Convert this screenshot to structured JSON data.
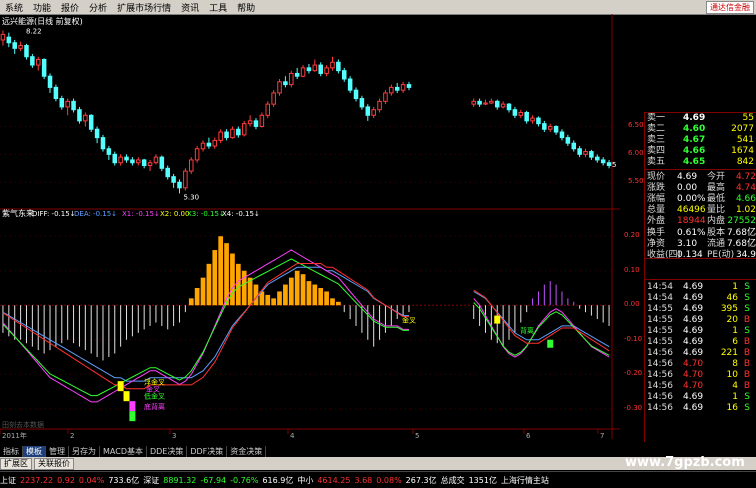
{
  "menu": [
    "系统",
    "功能",
    "报价",
    "分析",
    "扩展市场行情",
    "资讯",
    "工具",
    "帮助"
  ],
  "menu_right": "通达信金融",
  "chart_title": "远兴能源(日线 前复权)",
  "price_high_label": "8.22",
  "price_low_label": "5.30",
  "right_axis_labels": [
    "6.50",
    "6.00",
    "5.50",
    "5"
  ],
  "indicator_header": {
    "name": "紫气东来",
    "diff": "DIFF: -0.15↓",
    "dea": "DEA: -0.15↓",
    "x1": "X1: -0.15↓",
    "x2": "X2: 0.00",
    "x3": "X3: -0.15↓",
    "x4": "X4: -0.15↓"
  },
  "indicator_axis_labels": [
    "0.20",
    "0.10",
    "0.00",
    "-0.10",
    "-0.20",
    "-0.30"
  ],
  "indicator_annotations": [
    "浮金叉",
    "金叉",
    "低金叉",
    "底背离",
    "背离",
    "金叉"
  ],
  "xaxis": [
    "2011年",
    "2",
    "3",
    "4",
    "5",
    "6",
    "7"
  ],
  "copyright": "田刻去本数据",
  "quote_board": {
    "asks": [
      {
        "label": "卖一",
        "price": "4.69",
        "vol": "55"
      },
      {
        "label": "卖二",
        "price": "4.60",
        "vol": "2077"
      },
      {
        "label": "卖三",
        "price": "4.67",
        "vol": "541"
      },
      {
        "label": "卖四",
        "price": "4.66",
        "vol": "1674"
      },
      {
        "label": "卖五",
        "price": "4.65",
        "vol": "842"
      }
    ],
    "stats": [
      {
        "k1": "现价",
        "v1": "4.69",
        "k2": "今开",
        "v2": "4.72"
      },
      {
        "k1": "涨跌",
        "v1": "0.00",
        "k2": "最高",
        "v2": "4.74"
      },
      {
        "k1": "涨幅",
        "v1": "0.00%",
        "k2": "最低",
        "v2": "4.66"
      },
      {
        "k1": "总量",
        "v1": "46496",
        "k2": "量比",
        "v2": "1.02"
      },
      {
        "k1": "外盘",
        "v1": "18944",
        "k2": "内盘",
        "v2": "27552"
      },
      {
        "k1": "换手",
        "v1": "0.61%",
        "k2": "股本",
        "v2": "7.68亿"
      },
      {
        "k1": "净资",
        "v1": "3.10",
        "k2": "流通",
        "v2": "7.68亿"
      },
      {
        "k1": "收益(四)",
        "v1": "0.134",
        "k2": "PE(动)",
        "v2": "34.9"
      }
    ],
    "ticks": [
      {
        "t": "14:54",
        "p": "4.69",
        "v": "1",
        "d": "S"
      },
      {
        "t": "14:54",
        "p": "4.69",
        "v": "46",
        "d": "S"
      },
      {
        "t": "14:55",
        "p": "4.69",
        "v": "395",
        "d": "S"
      },
      {
        "t": "14:55",
        "p": "4.69",
        "v": "20",
        "d": "B"
      },
      {
        "t": "14:55",
        "p": "4.69",
        "v": "1",
        "d": "S"
      },
      {
        "t": "14:55",
        "p": "4.69",
        "v": "6",
        "d": "B"
      },
      {
        "t": "14:56",
        "p": "4.69",
        "v": "221",
        "d": "B"
      },
      {
        "t": "14:56",
        "p": "4.70",
        "v": "8",
        "d": "B"
      },
      {
        "t": "14:56",
        "p": "4.70",
        "v": "10",
        "d": "B"
      },
      {
        "t": "14:56",
        "p": "4.70",
        "v": "4",
        "d": "B"
      },
      {
        "t": "14:56",
        "p": "4.69",
        "v": "1",
        "d": "S"
      },
      {
        "t": "14:56",
        "p": "4.69",
        "v": "16",
        "d": "S"
      }
    ]
  },
  "tabs_row1": [
    "指标",
    "模板",
    "管理",
    "另存为",
    "MACD基本",
    "DDE决策",
    "DDF决策",
    "资金决策"
  ],
  "tabs_row2": [
    "扩展区",
    "关联报价"
  ],
  "status": {
    "sh_label": "上证",
    "sh_val": "2237.22",
    "sh_chg": "0.92",
    "sh_pct": "0.04%",
    "sh_amt": "733.6亿",
    "sz_label": "深证",
    "sz_val": "8891.32",
    "sz_chg": "-67.94",
    "sz_pct": "-0.76%",
    "sz_amt": "616.9亿",
    "zx_label": "中小",
    "zx_val": "4614.25",
    "zx_chg": "3.68",
    "zx_pct": "0.08%",
    "zx_amt": "267.3亿",
    "zcj_label": "总成交",
    "zcj_val": "1351亿",
    "station": "上海行情主站"
  },
  "watermark": "www.7gpzb.com",
  "chart_data": {
    "type": "candlestick",
    "price_ylim": [
      5.2,
      8.3
    ],
    "candles": [
      [
        8.05,
        8.15,
        8.22,
        7.95
      ],
      [
        8.1,
        8.0,
        8.18,
        7.92
      ],
      [
        8.0,
        7.9,
        8.05,
        7.8
      ],
      [
        7.9,
        7.95,
        8.02,
        7.85
      ],
      [
        7.95,
        7.75,
        7.98,
        7.7
      ],
      [
        7.75,
        7.6,
        7.8,
        7.55
      ],
      [
        7.6,
        7.7,
        7.75,
        7.5
      ],
      [
        7.7,
        7.4,
        7.72,
        7.35
      ],
      [
        7.4,
        7.2,
        7.45,
        7.1
      ],
      [
        7.2,
        7.0,
        7.25,
        6.95
      ],
      [
        7.0,
        6.85,
        7.05,
        6.8
      ],
      [
        6.85,
        6.95,
        7.0,
        6.7
      ],
      [
        6.95,
        6.8,
        7.0,
        6.75
      ],
      [
        6.8,
        6.6,
        6.85,
        6.55
      ],
      [
        6.6,
        6.7,
        6.75,
        6.5
      ],
      [
        6.7,
        6.45,
        6.72,
        6.4
      ],
      [
        6.45,
        6.3,
        6.5,
        6.2
      ],
      [
        6.3,
        6.1,
        6.35,
        6.05
      ],
      [
        6.1,
        6.0,
        6.15,
        5.9
      ],
      [
        6.0,
        5.85,
        6.05,
        5.8
      ],
      [
        5.85,
        5.95,
        6.0,
        5.8
      ],
      [
        5.95,
        5.9,
        6.0,
        5.85
      ],
      [
        5.9,
        5.85,
        5.95,
        5.8
      ],
      [
        5.85,
        5.9,
        5.95,
        5.8
      ],
      [
        5.9,
        5.8,
        5.92,
        5.75
      ],
      [
        5.8,
        5.85,
        5.9,
        5.7
      ],
      [
        5.85,
        5.95,
        6.0,
        5.82
      ],
      [
        5.95,
        5.75,
        5.98,
        5.7
      ],
      [
        5.75,
        5.6,
        5.8,
        5.55
      ],
      [
        5.6,
        5.5,
        5.65,
        5.4
      ],
      [
        5.5,
        5.4,
        5.55,
        5.3
      ],
      [
        5.4,
        5.7,
        5.75,
        5.35
      ],
      [
        5.7,
        5.9,
        5.95,
        5.65
      ],
      [
        5.9,
        6.1,
        6.15,
        5.85
      ],
      [
        6.1,
        6.2,
        6.25,
        6.05
      ],
      [
        6.2,
        6.15,
        6.3,
        6.1
      ],
      [
        6.15,
        6.25,
        6.3,
        6.1
      ],
      [
        6.25,
        6.4,
        6.45,
        6.2
      ],
      [
        6.4,
        6.3,
        6.45,
        6.25
      ],
      [
        6.3,
        6.45,
        6.5,
        6.28
      ],
      [
        6.45,
        6.35,
        6.5,
        6.3
      ],
      [
        6.35,
        6.55,
        6.6,
        6.32
      ],
      [
        6.55,
        6.6,
        6.7,
        6.5
      ],
      [
        6.6,
        6.5,
        6.65,
        6.45
      ],
      [
        6.5,
        6.7,
        6.75,
        6.48
      ],
      [
        6.7,
        6.9,
        6.95,
        6.65
      ],
      [
        6.9,
        7.1,
        7.15,
        6.85
      ],
      [
        7.1,
        7.3,
        7.35,
        7.05
      ],
      [
        7.3,
        7.25,
        7.4,
        7.2
      ],
      [
        7.25,
        7.45,
        7.5,
        7.2
      ],
      [
        7.45,
        7.4,
        7.55,
        7.35
      ],
      [
        7.4,
        7.55,
        7.6,
        7.38
      ],
      [
        7.55,
        7.5,
        7.62,
        7.45
      ],
      [
        7.5,
        7.6,
        7.7,
        7.48
      ],
      [
        7.6,
        7.45,
        7.65,
        7.4
      ],
      [
        7.45,
        7.55,
        7.6,
        7.4
      ],
      [
        7.55,
        7.65,
        7.75,
        7.5
      ],
      [
        7.65,
        7.5,
        7.7,
        7.45
      ],
      [
        7.5,
        7.35,
        7.55,
        7.3
      ],
      [
        7.35,
        7.15,
        7.4,
        7.1
      ],
      [
        7.15,
        7.0,
        7.2,
        6.95
      ],
      [
        7.0,
        6.85,
        7.05,
        6.8
      ],
      [
        6.85,
        6.7,
        6.9,
        6.6
      ],
      [
        6.7,
        6.8,
        6.85,
        6.65
      ],
      [
        6.8,
        6.95,
        7.0,
        6.75
      ],
      [
        6.95,
        7.1,
        7.15,
        6.9
      ],
      [
        7.1,
        7.2,
        7.25,
        7.05
      ],
      [
        7.2,
        7.15,
        7.28,
        7.1
      ],
      [
        7.15,
        7.25,
        7.3,
        7.1
      ],
      [
        7.25,
        7.2,
        7.3,
        7.15
      ],
      [
        null,
        null,
        null,
        null
      ],
      [
        null,
        null,
        null,
        null
      ],
      [
        null,
        null,
        null,
        null
      ],
      [
        null,
        null,
        null,
        null
      ],
      [
        null,
        null,
        null,
        null
      ],
      [
        null,
        null,
        null,
        null
      ],
      [
        null,
        null,
        null,
        null
      ],
      [
        null,
        null,
        null,
        null
      ],
      [
        null,
        null,
        null,
        null
      ],
      [
        null,
        null,
        null,
        null
      ],
      [
        6.9,
        6.95,
        7.0,
        6.85
      ],
      [
        6.95,
        6.9,
        7.0,
        6.85
      ],
      [
        6.9,
        6.92,
        6.98,
        6.88
      ],
      [
        6.92,
        6.95,
        7.0,
        6.9
      ],
      [
        6.95,
        6.85,
        6.98,
        6.8
      ],
      [
        6.85,
        6.9,
        6.95,
        6.82
      ],
      [
        6.9,
        6.8,
        6.92,
        6.75
      ],
      [
        6.8,
        6.7,
        6.85,
        6.65
      ],
      [
        6.7,
        6.75,
        6.8,
        6.65
      ],
      [
        6.75,
        6.6,
        6.78,
        6.55
      ],
      [
        6.6,
        6.65,
        6.7,
        6.55
      ],
      [
        6.65,
        6.55,
        6.68,
        6.5
      ],
      [
        6.55,
        6.45,
        6.6,
        6.4
      ],
      [
        6.45,
        6.5,
        6.55,
        6.4
      ],
      [
        6.5,
        6.4,
        6.52,
        6.35
      ],
      [
        6.4,
        6.3,
        6.45,
        6.25
      ],
      [
        6.3,
        6.2,
        6.35,
        6.15
      ],
      [
        6.2,
        6.1,
        6.25,
        6.05
      ],
      [
        6.1,
        6.0,
        6.15,
        5.95
      ],
      [
        6.0,
        6.05,
        6.1,
        5.95
      ],
      [
        6.05,
        5.95,
        6.08,
        5.9
      ],
      [
        5.95,
        5.9,
        6.0,
        5.85
      ],
      [
        5.9,
        5.85,
        5.95,
        5.8
      ],
      [
        5.85,
        5.8,
        5.9,
        5.75
      ]
    ],
    "macd_ylim": [
      -0.35,
      0.25
    ],
    "hist": [
      -0.08,
      -0.09,
      -0.1,
      -0.1,
      -0.11,
      -0.12,
      -0.13,
      -0.14,
      -0.13,
      -0.12,
      -0.11,
      -0.1,
      -0.11,
      -0.12,
      -0.13,
      -0.14,
      -0.15,
      -0.16,
      -0.15,
      -0.14,
      -0.12,
      -0.1,
      -0.09,
      -0.08,
      -0.07,
      -0.06,
      -0.05,
      -0.06,
      -0.07,
      -0.06,
      -0.05,
      -0.02,
      0.02,
      0.05,
      0.08,
      0.12,
      0.16,
      0.2,
      0.18,
      0.15,
      0.12,
      0.1,
      0.08,
      0.06,
      0.04,
      0.03,
      0.02,
      0.04,
      0.06,
      0.08,
      0.1,
      0.09,
      0.07,
      0.06,
      0.05,
      0.04,
      0.02,
      0.01,
      -0.02,
      -0.04,
      -0.06,
      -0.08,
      -0.1,
      -0.12,
      -0.1,
      -0.08,
      -0.06,
      -0.04,
      -0.03,
      -0.02,
      null,
      null,
      null,
      null,
      null,
      null,
      null,
      null,
      null,
      null,
      -0.04,
      -0.06,
      -0.08,
      -0.1,
      -0.11,
      -0.12,
      -0.1,
      -0.08,
      -0.05,
      -0.02,
      0.02,
      0.04,
      0.06,
      0.07,
      0.06,
      0.04,
      0.02,
      0.01,
      -0.01,
      -0.02,
      -0.03,
      -0.04,
      -0.05,
      -0.06
    ],
    "diff": [
      -0.05,
      -0.07,
      -0.09,
      -0.11,
      -0.13,
      -0.15,
      -0.17,
      -0.19,
      -0.21,
      -0.22,
      -0.23,
      -0.24,
      -0.25,
      -0.26,
      -0.27,
      -0.28,
      -0.28,
      -0.27,
      -0.26,
      -0.25,
      -0.24,
      -0.23,
      -0.22,
      -0.21,
      -0.2,
      -0.19,
      -0.19,
      -0.2,
      -0.21,
      -0.22,
      -0.23,
      -0.22,
      -0.2,
      -0.17,
      -0.14,
      -0.1,
      -0.06,
      -0.02,
      0.02,
      0.05,
      0.07,
      0.08,
      0.09,
      0.1,
      0.11,
      0.12,
      0.13,
      0.14,
      0.15,
      0.16,
      0.15,
      0.14,
      0.13,
      0.12,
      0.11,
      0.1,
      0.09,
      0.08,
      0.06,
      0.04,
      0.02,
      0.0,
      -0.02,
      -0.04,
      -0.05,
      -0.06,
      -0.06,
      -0.06,
      -0.07,
      -0.07,
      null,
      null,
      null,
      null,
      null,
      null,
      null,
      null,
      null,
      null,
      0.02,
      0.0,
      -0.03,
      -0.06,
      -0.09,
      -0.12,
      -0.14,
      -0.15,
      -0.14,
      -0.12,
      -0.09,
      -0.06,
      -0.04,
      -0.02,
      -0.01,
      -0.02,
      -0.04,
      -0.06,
      -0.08,
      -0.1,
      -0.12,
      -0.13,
      -0.14,
      -0.15
    ],
    "dea": [
      -0.02,
      -0.03,
      -0.04,
      -0.05,
      -0.06,
      -0.07,
      -0.08,
      -0.09,
      -0.1,
      -0.11,
      -0.12,
      -0.13,
      -0.14,
      -0.15,
      -0.16,
      -0.17,
      -0.18,
      -0.19,
      -0.2,
      -0.21,
      -0.21,
      -0.22,
      -0.22,
      -0.22,
      -0.22,
      -0.21,
      -0.21,
      -0.21,
      -0.21,
      -0.21,
      -0.21,
      -0.21,
      -0.21,
      -0.2,
      -0.19,
      -0.17,
      -0.15,
      -0.12,
      -0.09,
      -0.06,
      -0.04,
      -0.02,
      0.0,
      0.02,
      0.04,
      0.06,
      0.07,
      0.08,
      0.09,
      0.1,
      0.11,
      0.11,
      0.11,
      0.11,
      0.11,
      0.1,
      0.1,
      0.09,
      0.08,
      0.07,
      0.06,
      0.05,
      0.04,
      0.02,
      0.01,
      0.0,
      -0.01,
      -0.02,
      -0.03,
      -0.03,
      null,
      null,
      null,
      null,
      null,
      null,
      null,
      null,
      null,
      null,
      0.04,
      0.03,
      0.02,
      0.0,
      -0.02,
      -0.04,
      -0.06,
      -0.08,
      -0.09,
      -0.1,
      -0.1,
      -0.1,
      -0.09,
      -0.08,
      -0.07,
      -0.06,
      -0.06,
      -0.06,
      -0.07,
      -0.08,
      -0.09,
      -0.1,
      -0.11,
      -0.12
    ]
  }
}
